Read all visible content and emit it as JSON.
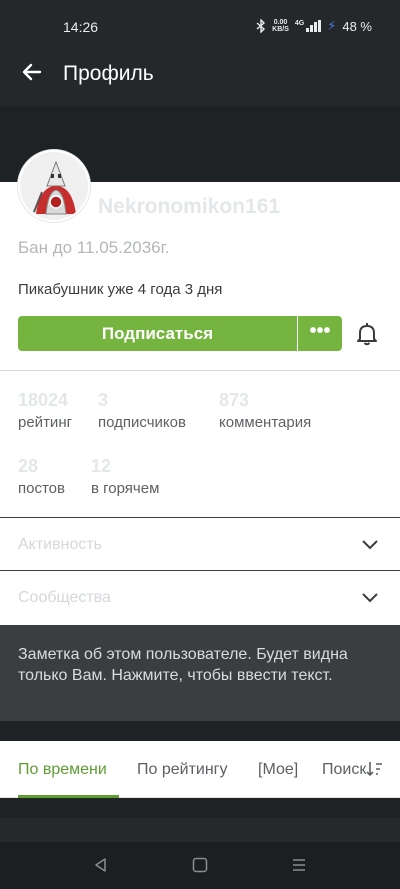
{
  "status_bar": {
    "time": "14:26",
    "net_speed": "0.00",
    "net_unit": "KB/S",
    "network_type": "4G",
    "battery": "48 %",
    "icons": [
      "bluetooth-icon",
      "signal-icon",
      "charging-icon"
    ]
  },
  "app_bar": {
    "back_icon": "arrow-left-icon",
    "title": "Профиль"
  },
  "profile": {
    "username": "Nekronomikon161",
    "ban_text": "Бан до 11.05.2036г.",
    "member_since": "Пикабушник уже 4 года 3 дня",
    "subscribe_label": "Подписаться",
    "more_label": "•••",
    "bell_icon": "bell-icon",
    "accent_color": "#76b440"
  },
  "stats": [
    {
      "value": "18024",
      "label": "рейтинг"
    },
    {
      "value": "3",
      "label": "подписчиков"
    },
    {
      "value": "873",
      "label": "комментария"
    },
    {
      "value": "28",
      "label": "постов"
    },
    {
      "value": "12",
      "label": "в горячем"
    }
  ],
  "sections": {
    "activity": "Активность",
    "communities": "Сообщества"
  },
  "note": {
    "placeholder": "Заметка об этом пользователе. Будет видна только Вам. Нажмите, чтобы ввести текст."
  },
  "tabs": [
    {
      "label": "По времени",
      "active": true
    },
    {
      "label": "По рейтингу",
      "active": false
    },
    {
      "label": "[Мое]",
      "active": false
    },
    {
      "label": "Поиск",
      "active": false
    }
  ],
  "nav_bar": {
    "icons": [
      "back-triangle-icon",
      "home-square-icon",
      "menu-lines-icon"
    ]
  }
}
